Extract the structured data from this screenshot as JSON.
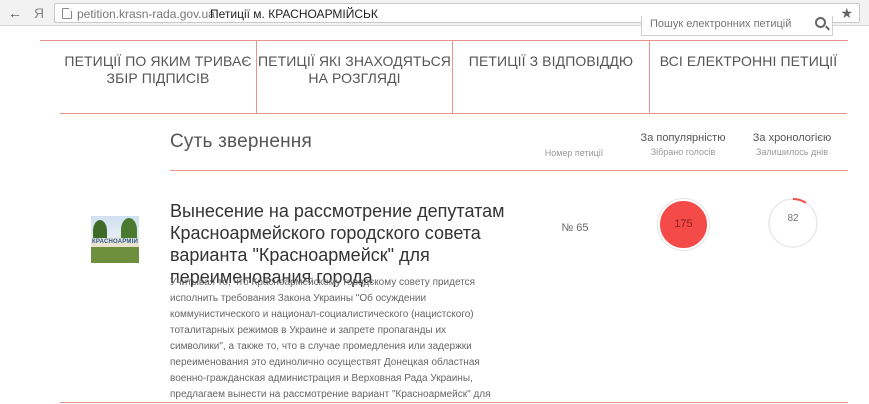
{
  "browser": {
    "back_label": "←",
    "reload_label": "Я",
    "url": "petition.krasn-rada.gov.ua",
    "page_title": "Петиції м. КРАСНОАРМІЙСЬК",
    "star_label": "★"
  },
  "search": {
    "placeholder": "Пошук електронних петицій"
  },
  "tabs": [
    {
      "label": "ПЕТИЦІЇ ПО ЯКИМ ТРИВАЄ ЗБІР ПІДПИСІВ"
    },
    {
      "label": "ПЕТИЦІЇ ЯКІ ЗНАХОДЯТЬСЯ НА РОЗГЛЯДІ"
    },
    {
      "label": "ПЕТИЦІЇ З ВІДПОВІДДЮ"
    },
    {
      "label": "ВСІ ЕЛЕКТРОННІ ПЕТИЦІЇ"
    }
  ],
  "columns": {
    "main": "Суть звернення",
    "number": "Номер петиції",
    "popularity": {
      "title": "За популярністю",
      "sub": "Зібрано голосів"
    },
    "chronology": {
      "title": "За хронологією",
      "sub": "Залишилось днів"
    }
  },
  "petitions": [
    {
      "image_text": "КРАСНОАРМІЙ",
      "title": "Вынесение на рассмотрение депутатам Красноармейского городского совета варианта \"Красноармейск\" для переименования города",
      "description": "Учитывая то, что Красноармейскому городскому совету придется исполнить требования Закона Украины \"Об осуждении коммунистического и национал-социалистического (нацистского) тоталитарных режимов в Украине и запрете пропаганды их символики\", а также то, что в случае промедления или задержки переименования это единолично осуществят Донецкая областная военно-гражданская администрация и Верховная Рада Украины, предлагаем вынести на рассмотрение вариант \"Красноармейск\" для переименования города, изменив",
      "number": "№ 65",
      "votes": "175",
      "days_left": "82",
      "days_fraction": 0.09
    }
  ],
  "colors": {
    "accent_line": "#e8938b",
    "votes_fill": "#f44b48"
  },
  "icons": {
    "back": "arrow-left-icon",
    "reload": "reload-icon",
    "page": "page-icon",
    "star": "star-icon",
    "search": "search-icon"
  }
}
